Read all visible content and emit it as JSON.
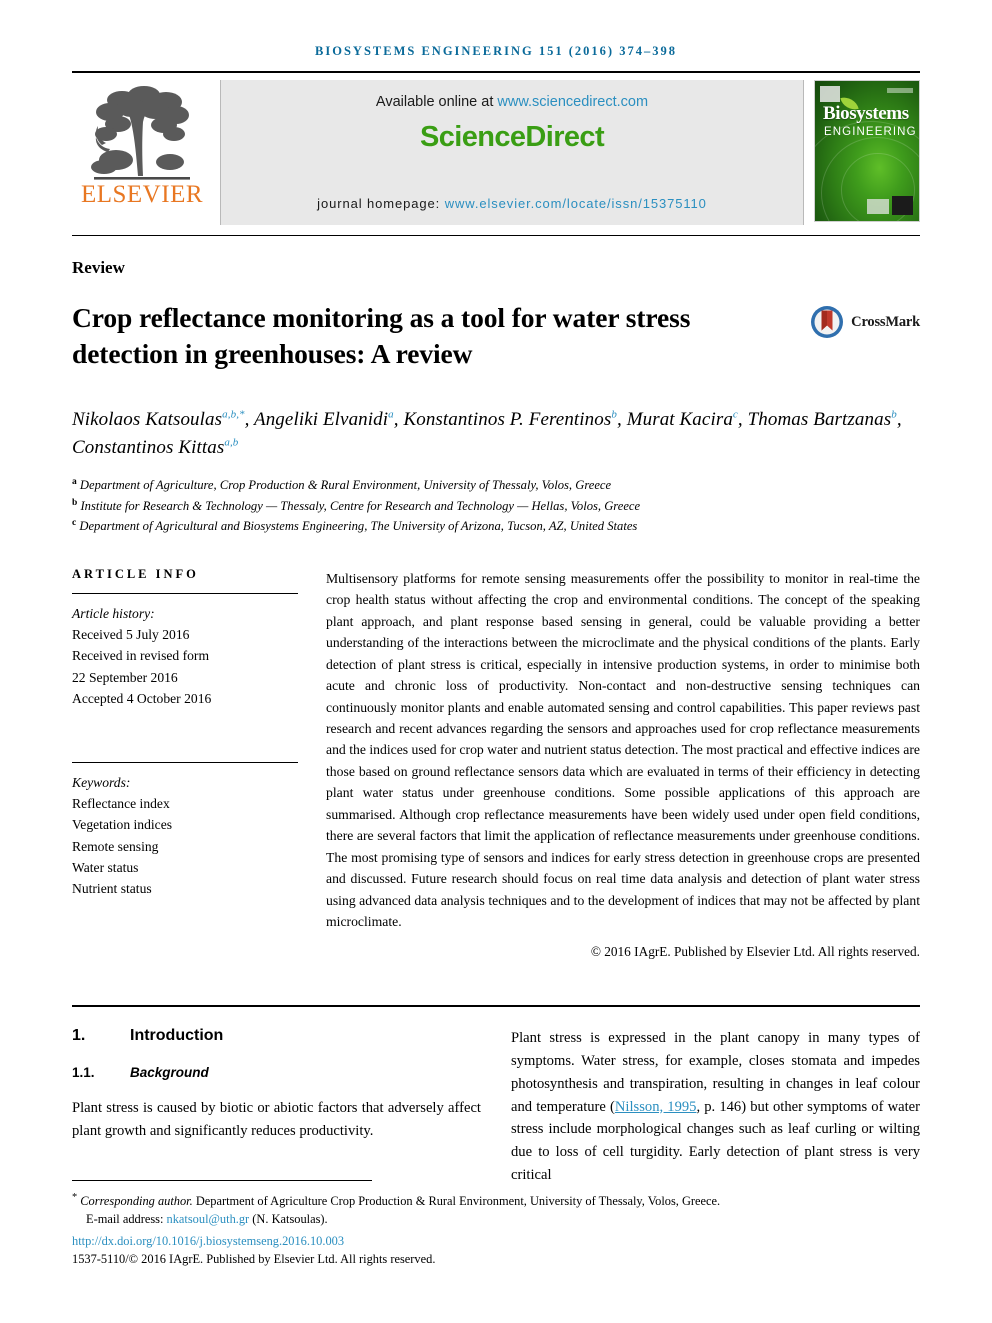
{
  "running_head": "BIOSYSTEMS ENGINEERING 151 (2016) 374–398",
  "masthead": {
    "publisher_name": "ELSEVIER",
    "available_label": "Available online at",
    "available_url": "www.sciencedirect.com",
    "sciencedirect_logo": "ScienceDirect",
    "homepage_label": "journal homepage:",
    "homepage_url": "www.elsevier.com/locate/issn/15375110",
    "cover": {
      "title": "Biosystems",
      "subtitle": "ENGINEERING"
    }
  },
  "article": {
    "type": "Review",
    "title": "Crop reflectance monitoring as a tool for water stress detection in greenhouses: A review",
    "crossmark_label": "CrossMark",
    "authors_line1": "Nikolaos Katsoulas",
    "authors": [
      {
        "name": "Nikolaos Katsoulas",
        "sup": "a,b,*"
      },
      {
        "name": "Angeliki Elvanidi",
        "sup": "a"
      },
      {
        "name": "Konstantinos P. Ferentinos",
        "sup": "b"
      },
      {
        "name": "Murat Kacira",
        "sup": "c"
      },
      {
        "name": "Thomas Bartzanas",
        "sup": "b"
      },
      {
        "name": "Constantinos Kittas",
        "sup": "a,b"
      }
    ],
    "affiliations": [
      {
        "marker": "a",
        "text": "Department of Agriculture, Crop Production & Rural Environment, University of Thessaly, Volos, Greece"
      },
      {
        "marker": "b",
        "text": "Institute for Research & Technology — Thessaly, Centre for Research and Technology — Hellas, Volos, Greece"
      },
      {
        "marker": "c",
        "text": "Department of Agricultural and Biosystems Engineering, The University of Arizona, Tucson, AZ, United States"
      }
    ]
  },
  "article_info": {
    "heading": "ARTICLE INFO",
    "history_label": "Article history:",
    "history": [
      "Received 5 July 2016",
      "Received in revised form",
      "22 September 2016",
      "Accepted 4 October 2016"
    ],
    "keywords_label": "Keywords:",
    "keywords": [
      "Reflectance index",
      "Vegetation indices",
      "Remote sensing",
      "Water status",
      "Nutrient status"
    ]
  },
  "abstract": {
    "text": "Multisensory platforms for remote sensing measurements offer the possibility to monitor in real-time the crop health status without affecting the crop and environmental conditions. The concept of the speaking plant approach, and plant response based sensing in general, could be valuable providing a better understanding of the interactions between the microclimate and the physical conditions of the plants. Early detection of plant stress is critical, especially in intensive production systems, in order to minimise both acute and chronic loss of productivity. Non-contact and non-destructive sensing techniques can continuously monitor plants and enable automated sensing and control capabilities. This paper reviews past research and recent advances regarding the sensors and approaches used for crop reflectance measurements and the indices used for crop water and nutrient status detection. The most practical and effective indices are those based on ground reflectance sensors data which are evaluated in terms of their efficiency in detecting plant water status under greenhouse conditions. Some possible applications of this approach are summarised. Although crop reflectance measurements have been widely used under open field conditions, there are several factors that limit the application of reflectance measurements under greenhouse conditions. The most promising type of sensors and indices for early stress detection in greenhouse crops are presented and discussed. Future research should focus on real time data analysis and detection of plant water stress using advanced data analysis techniques and to the development of indices that may not be affected by plant microclimate.",
    "copyright": "© 2016 IAgrE. Published by Elsevier Ltd. All rights reserved."
  },
  "body": {
    "section_number": "1.",
    "section_title": "Introduction",
    "subsection_number": "1.1.",
    "subsection_title": "Background",
    "left_paragraph": "Plant stress is caused by biotic or abiotic factors that adversely affect plant growth and significantly reduces productivity.",
    "right_paragraph_part1": "Plant stress is expressed in the plant canopy in many types of symptoms. Water stress, for example, closes stomata and impedes photosynthesis and transpiration, resulting in changes in leaf colour and temperature (",
    "right_citation": "Nilsson, 1995",
    "right_paragraph_part2": ", p. 146) but other symptoms of water stress include morphological changes such as leaf curling or wilting due to loss of cell turgidity. Early detection of plant stress is very critical"
  },
  "footer": {
    "corresponding_marker": "*",
    "corresponding_label": "Corresponding author.",
    "corresponding_address": " Department of Agriculture Crop Production & Rural Environment, University of Thessaly, Volos, Greece.",
    "email_label": "E-mail address:",
    "email": "nkatsoul@uth.gr",
    "email_owner": "(N. Katsoulas).",
    "doi": "http://dx.doi.org/10.1016/j.biosystemseng.2016.10.003",
    "issn_line": "1537-5110/© 2016 IAgrE. Published by Elsevier Ltd. All rights reserved."
  },
  "colors": {
    "journal_blue": "#0a6a9a",
    "link_blue": "#2b8fc0",
    "elsevier_orange": "#e87722",
    "sciencedirect_green": "#3a9e14"
  }
}
